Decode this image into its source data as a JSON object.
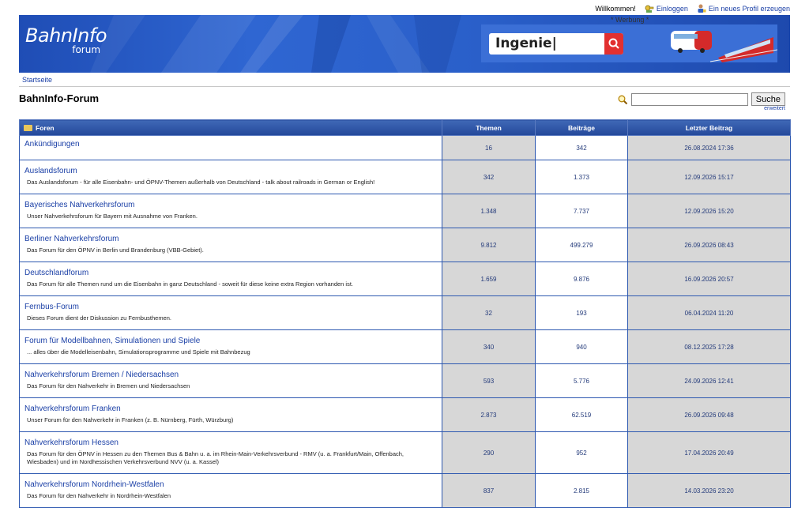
{
  "userbar": {
    "welcome": "Willkommen!",
    "login": "Einloggen",
    "register": "Ein neues Profil erzeugen"
  },
  "header": {
    "logo_main": "BahnInfo",
    "logo_sub": "forum",
    "ad_label": "* Werbung *",
    "ad_search_text": "Ingenie|"
  },
  "breadcrumb": {
    "home": "Startseite"
  },
  "page": {
    "title": "BahnInfo-Forum"
  },
  "search": {
    "button": "Suche",
    "extended": "erweitert",
    "value": ""
  },
  "table": {
    "headers": {
      "forums": "Foren",
      "topics": "Themen",
      "posts": "Beiträge",
      "last_post": "Letzter Beitrag"
    },
    "rows": [
      {
        "name": "Ankündigungen",
        "desc": "",
        "topics": "16",
        "posts": "342",
        "last": "26.08.2024 17:36"
      },
      {
        "name": "Auslandsforum",
        "desc": "Das Auslandsforum - für alle Eisenbahn- und ÖPNV-Themen außerhalb von Deutschland - talk about railroads in German or English!",
        "topics": "342",
        "posts": "1.373",
        "last": "12.09.2026 15:17"
      },
      {
        "name": "Bayerisches Nahverkehrsforum",
        "desc": "Unser Nahverkehrsforum für Bayern mit Ausnahme von Franken.",
        "topics": "1.348",
        "posts": "7.737",
        "last": "12.09.2026 15:20"
      },
      {
        "name": "Berliner Nahverkehrsforum",
        "desc": "Das Forum für den ÖPNV in Berlin und Brandenburg (VBB-Gebiet).",
        "topics": "9.812",
        "posts": "499.279",
        "last": "26.09.2026 08:43"
      },
      {
        "name": "Deutschlandforum",
        "desc": "Das Forum für alle Themen rund um die Eisenbahn in ganz Deutschland - soweit für diese keine extra Region vorhanden ist.",
        "topics": "1.659",
        "posts": "9.876",
        "last": "16.09.2026 20:57"
      },
      {
        "name": "Fernbus-Forum",
        "desc": "Dieses Forum dient der Diskussion zu Fernbusthemen.",
        "topics": "32",
        "posts": "193",
        "last": "06.04.2024 11:20"
      },
      {
        "name": "Forum für Modellbahnen, Simulationen und Spiele",
        "desc": "... alles über die Modelleisenbahn, Simulationsprogramme und Spiele mit Bahnbezug",
        "topics": "340",
        "posts": "940",
        "last": "08.12.2025 17:28"
      },
      {
        "name": "Nahverkehrsforum Bremen / Niedersachsen",
        "desc": "Das Forum für den Nahverkehr in Bremen und Niedersachsen",
        "topics": "593",
        "posts": "5.776",
        "last": "24.09.2026 12:41"
      },
      {
        "name": "Nahverkehrsforum Franken",
        "desc": "Unser Forum für den Nahverkehr in Franken (z. B. Nürnberg, Fürth, Würzburg)",
        "topics": "2.873",
        "posts": "62.519",
        "last": "26.09.2026 09:48"
      },
      {
        "name": "Nahverkehrsforum Hessen",
        "desc": "Das Forum für den ÖPNV in Hessen zu den Themen Bus & Bahn u. a. im Rhein-Main-Verkehrsverbund - RMV (u. a. Frankfurt/Main, Offenbach, Wiesbaden) und im Nordhessischen Verkehrsverbund NVV (u. a. Kassel)",
        "topics": "290",
        "posts": "952",
        "last": "17.04.2026 20:49"
      },
      {
        "name": "Nahverkehrsforum Nordrhein-Westfalen",
        "desc": "Das Forum für den Nahverkehr in Nordrhein-Westfalen",
        "topics": "837",
        "posts": "2.815",
        "last": "14.03.2026 23:20"
      }
    ]
  },
  "colors": {
    "header_blue": "#2f66d2",
    "table_header": "#24489a",
    "link": "#1a3fa6",
    "cell_grey": "#d7d7d7"
  },
  "icons": [
    "login-icon",
    "register-icon",
    "search-icon",
    "folder-icon",
    "ad-search-icon"
  ]
}
